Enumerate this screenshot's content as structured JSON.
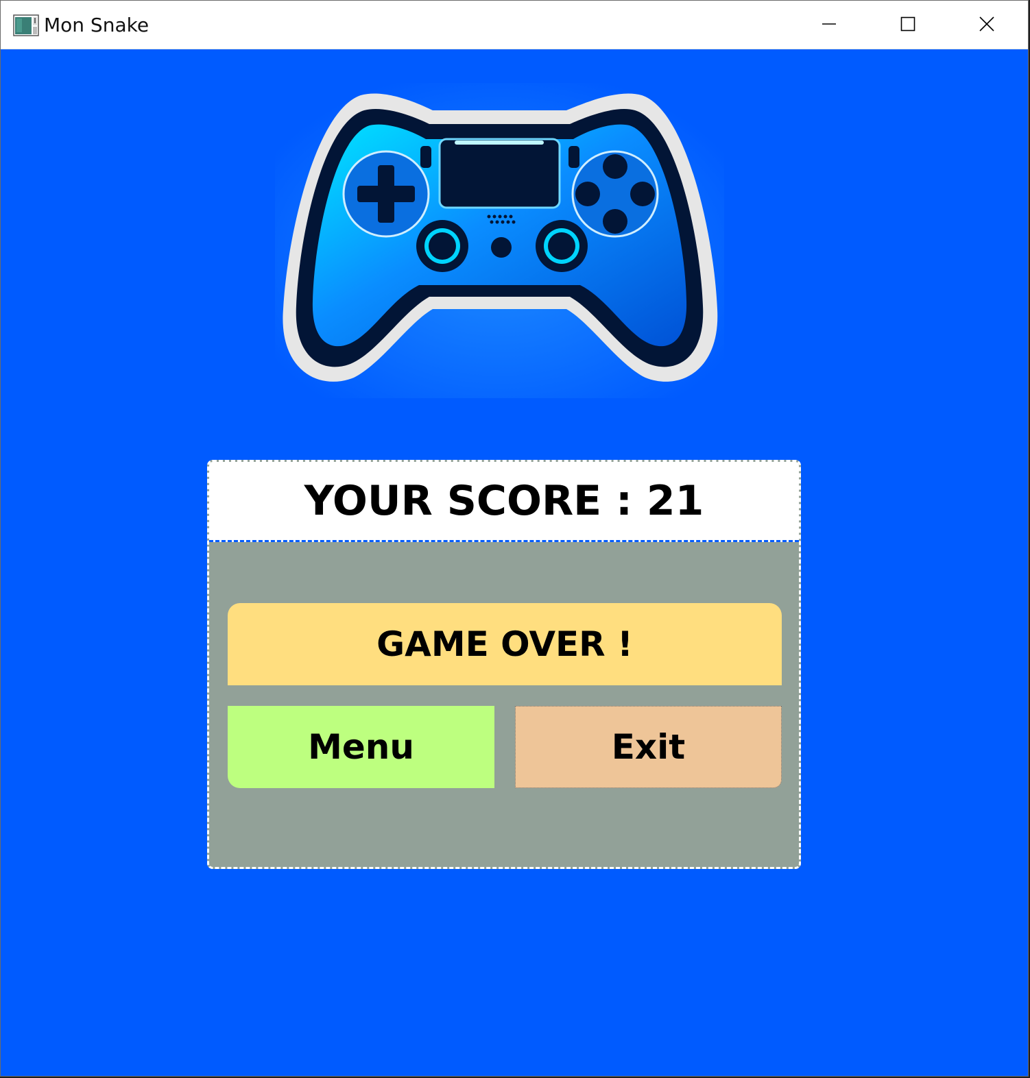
{
  "window": {
    "title": "Mon Snake",
    "icons": {
      "app": "app-window-icon",
      "minimize": "minimize-icon",
      "maximize": "maximize-icon",
      "close": "close-icon"
    }
  },
  "content": {
    "logo": "gamepad-icon",
    "score_text": "YOUR SCORE : 21",
    "game_over_text": "GAME OVER !",
    "menu_label": "Menu",
    "exit_label": "Exit"
  },
  "colors": {
    "background": "#005bff",
    "panel": "#92a198",
    "game_over": "#ffde7f",
    "menu": "#bdff7f",
    "exit": "#eec598"
  }
}
